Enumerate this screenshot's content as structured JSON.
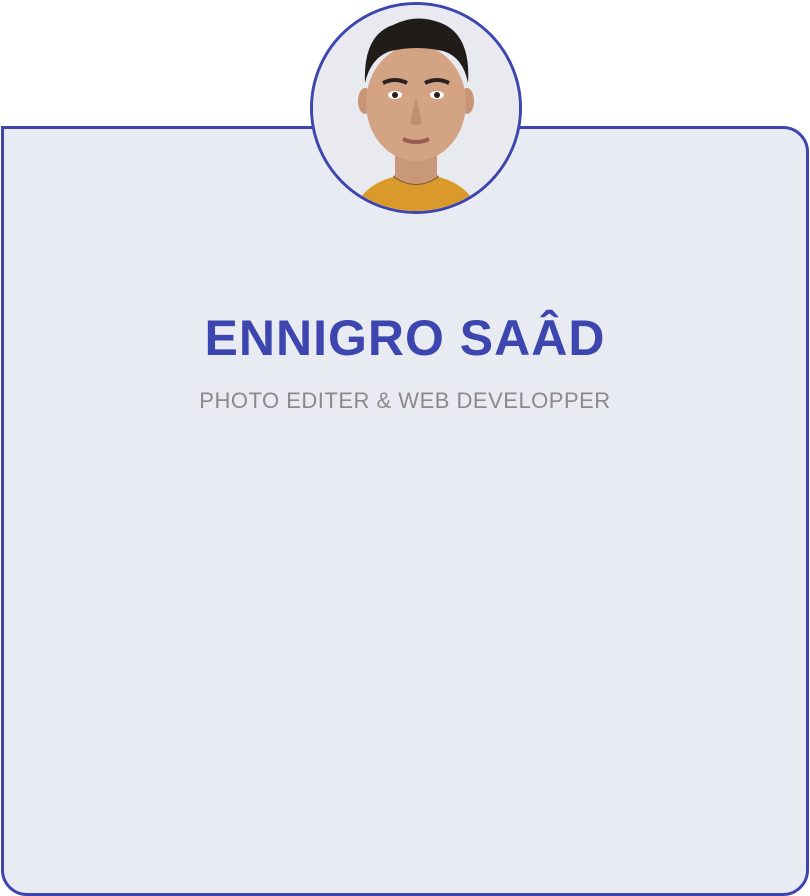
{
  "profile": {
    "name": "ENNIGRO SAÂD",
    "role": "PHOTO EDITER & WEB DEVELOPPER",
    "avatar_icon": "profile-photo"
  },
  "colors": {
    "accent": "#3d45ae",
    "card_bg": "#e9ebf2",
    "subtitle": "#8a8a8a"
  }
}
